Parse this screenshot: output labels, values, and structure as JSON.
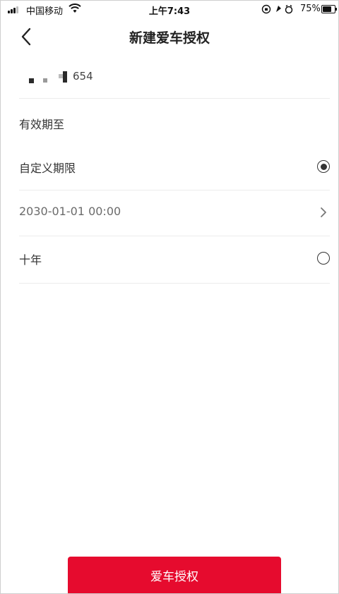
{
  "status_bar": {
    "carrier": "中国移动",
    "time": "上午7:43",
    "battery": "75%",
    "battery_level": 0.75
  },
  "nav": {
    "title": "新建爱车授权"
  },
  "plate": {
    "visible_suffix": "654"
  },
  "section": {
    "title": "有效期至"
  },
  "options": [
    {
      "label": "自定义期限",
      "selected": true
    },
    {
      "label": "2030-01-01 00:00"
    },
    {
      "label": "十年",
      "selected": false
    }
  ],
  "submit": {
    "label": "爱车授权"
  },
  "colors": {
    "primary": "#e60b2e"
  }
}
